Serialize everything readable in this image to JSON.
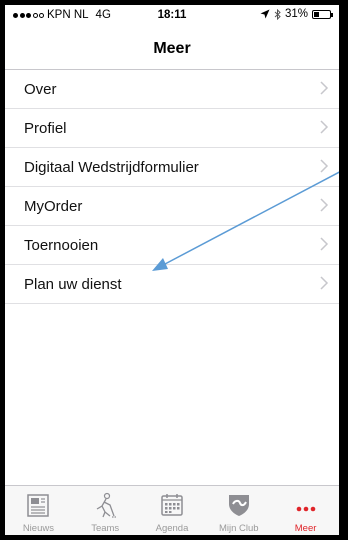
{
  "status": {
    "carrier": "KPN NL",
    "network": "4G",
    "time": "18:11",
    "battery_text": "31%",
    "battery_level": 0.31
  },
  "navbar": {
    "title": "Meer"
  },
  "menu": {
    "items": [
      {
        "label": "Over"
      },
      {
        "label": "Profiel"
      },
      {
        "label": "Digitaal Wedstrijdformulier"
      },
      {
        "label": "MyOrder"
      },
      {
        "label": "Toernooien"
      },
      {
        "label": "Plan uw dienst"
      }
    ]
  },
  "tabbar": {
    "tabs": [
      {
        "label": "Nieuws",
        "icon": "newspaper-icon"
      },
      {
        "label": "Teams",
        "icon": "hockey-player-icon"
      },
      {
        "label": "Agenda",
        "icon": "calendar-icon"
      },
      {
        "label": "Mijn Club",
        "icon": "club-shield-icon"
      },
      {
        "label": "Meer",
        "icon": "more-dots-icon",
        "active": true
      }
    ],
    "active_color": "#e0252a",
    "inactive_color": "#9a9a9a"
  },
  "annotation": {
    "arrow_color": "#5b9bd5"
  }
}
